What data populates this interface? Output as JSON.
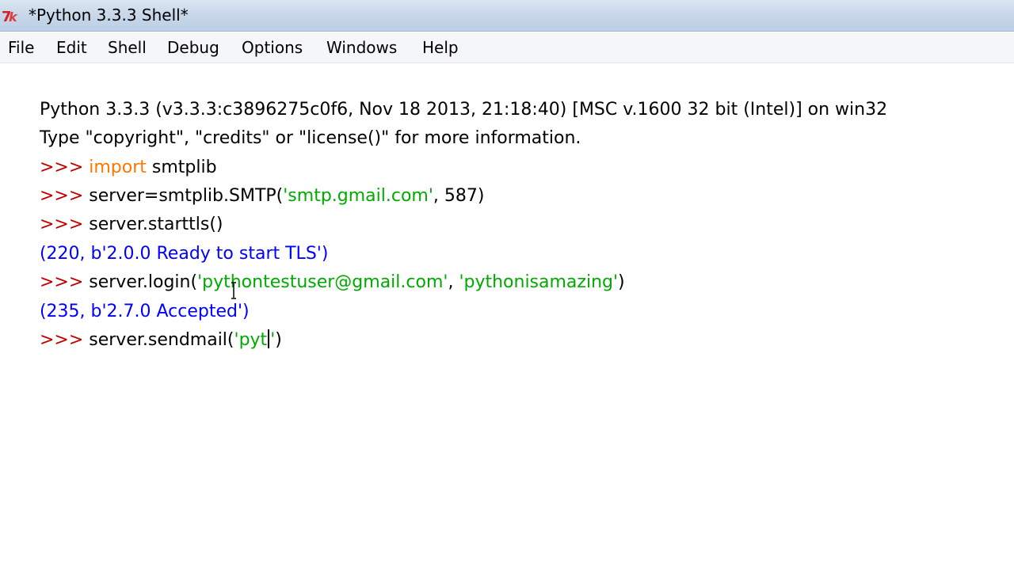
{
  "window": {
    "title": "*Python 3.3.3 Shell*"
  },
  "menu": [
    "File",
    "Edit",
    "Shell",
    "Debug",
    "Options",
    "Windows",
    "Help"
  ],
  "colors": {
    "prompt": "#c00000",
    "keyword": "#ff7700",
    "string": "#00aa00",
    "output": "#0000ff",
    "text": "#000000"
  },
  "shell": {
    "banner1": "Python 3.3.3 (v3.3.3:c3896275c0f6, Nov 18 2013, 21:18:40) [MSC v.1600 32 bit (Intel)] on win32",
    "banner2": "Type \"copyright\", \"credits\" or \"license()\" for more information.",
    "prompt": ">>> ",
    "l3_kw": "import",
    "l3_rest": " smtplib",
    "l4_a": "server=smtplib.SMTP(",
    "l4_str": "'smtp.gmail.com'",
    "l4_b": ", 587)",
    "l5": "server.starttls()",
    "out1": "(220, b'2.0.0 Ready to start TLS')",
    "l7_a": "server.login(",
    "l7_str1": "'pythontestuser@gmail.com'",
    "l7_b": ", ",
    "l7_str2": "'pythonisamazing'",
    "l7_c": ")",
    "out2": "(235, b'2.7.0 Accepted')",
    "l9_a": "server.sendmail(",
    "l9_str": "'pyt",
    "l9_str_close": "'",
    "l9_c": ")"
  }
}
